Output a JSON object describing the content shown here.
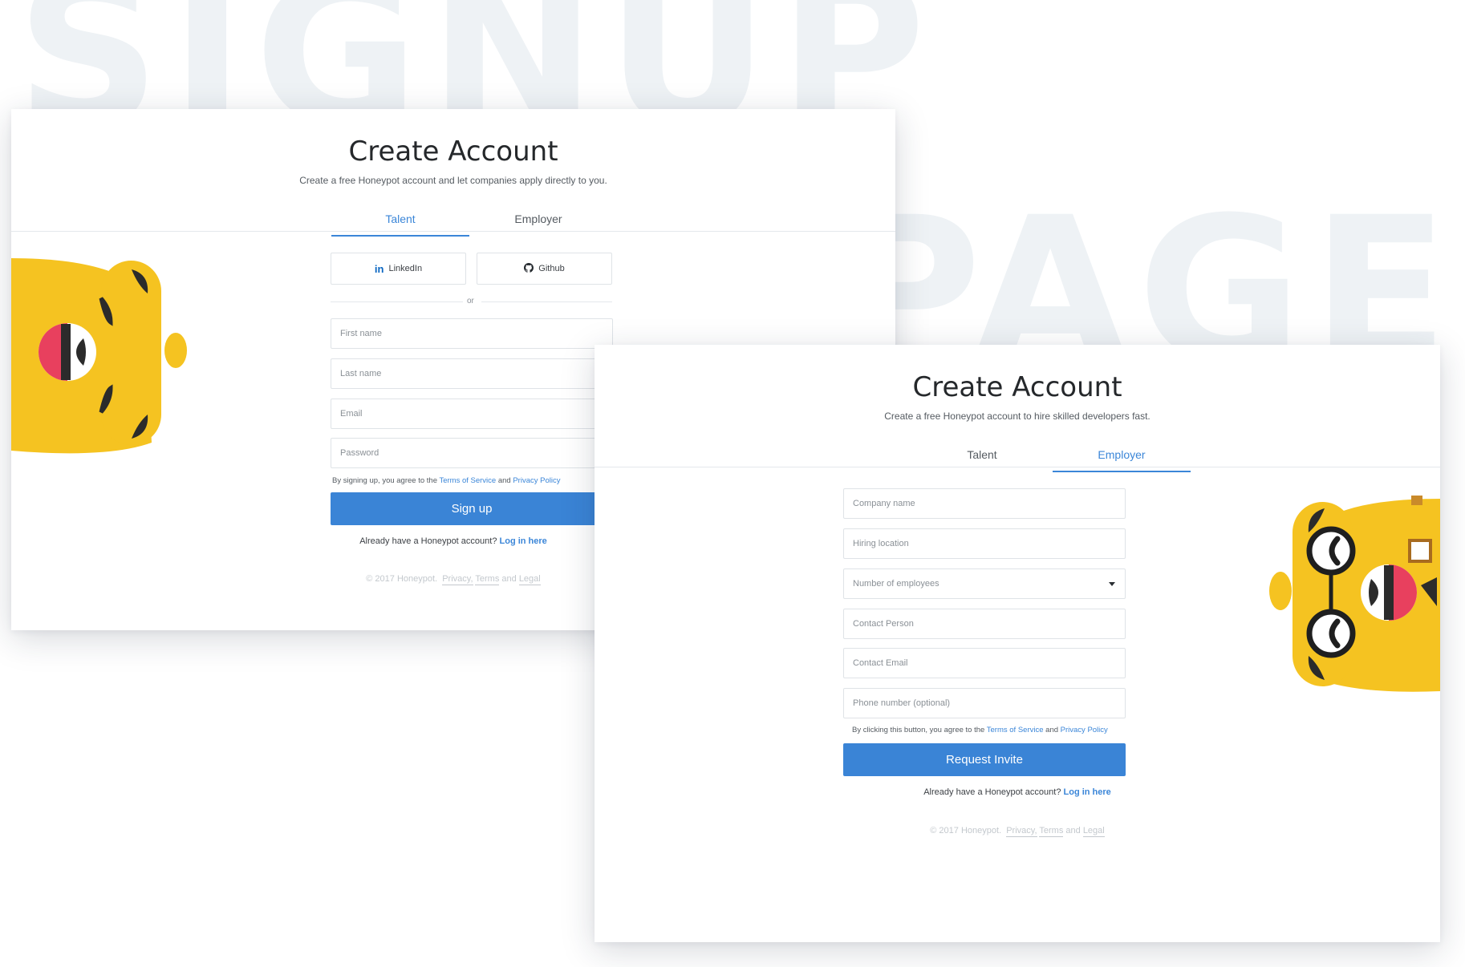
{
  "background": {
    "word_top": "SIGNUP",
    "word_bottom": "PAGE"
  },
  "talent_card": {
    "title": "Create Account",
    "subtitle": "Create a free Honeypot account and let companies apply directly to you.",
    "tabs": [
      {
        "label": "Talent",
        "active": true
      },
      {
        "label": "Employer",
        "active": false
      }
    ],
    "social": {
      "linkedin_label": "LinkedIn",
      "github_label": "Github"
    },
    "or_label": "or",
    "fields": {
      "first_name_placeholder": "First name",
      "last_name_placeholder": "Last name",
      "email_placeholder": "Email",
      "password_placeholder": "Password"
    },
    "agree": {
      "prefix": "By signing up, you agree to the ",
      "terms": "Terms of Service",
      "and": " and ",
      "privacy": "Privacy Policy"
    },
    "submit_label": "Sign up",
    "login": {
      "prompt": "Already have a Honeypot account? ",
      "link": "Log in here"
    },
    "footer": {
      "copyright": "© 2017 Honeypot.",
      "privacy": "Privacy,",
      "terms": "Terms",
      "and": " and ",
      "legal": "Legal"
    }
  },
  "employer_card": {
    "title": "Create Account",
    "subtitle": "Create a free Honeypot account to hire skilled developers fast.",
    "tabs": [
      {
        "label": "Talent",
        "active": false
      },
      {
        "label": "Employer",
        "active": true
      }
    ],
    "fields": {
      "company_placeholder": "Company name",
      "location_placeholder": "Hiring location",
      "employees_selected": "Number of employees",
      "contact_person_placeholder": "Contact Person",
      "contact_email_placeholder": "Contact Email",
      "phone_placeholder": "Phone number (optional)"
    },
    "agree": {
      "prefix": "By clicking this button, you agree to the  ",
      "terms": "Terms of Service",
      "and": " and ",
      "privacy": "Privacy Policy"
    },
    "submit_label": "Request Invite",
    "login": {
      "prompt": "Already have a Honeypot account? ",
      "link": "Log in here"
    },
    "footer": {
      "copyright": "© 2017 Honeypot.",
      "privacy": "Privacy,",
      "terms": "Terms",
      "and": " and ",
      "legal": "Legal"
    }
  },
  "colors": {
    "accent": "#3a84d6",
    "mascot_yellow": "#f5c321",
    "mascot_red": "#e8405e",
    "background_text": "#eef2f5"
  },
  "icons": [
    "linkedin-icon",
    "github-icon",
    "caret-down-icon",
    "honeypot-mascot"
  ]
}
